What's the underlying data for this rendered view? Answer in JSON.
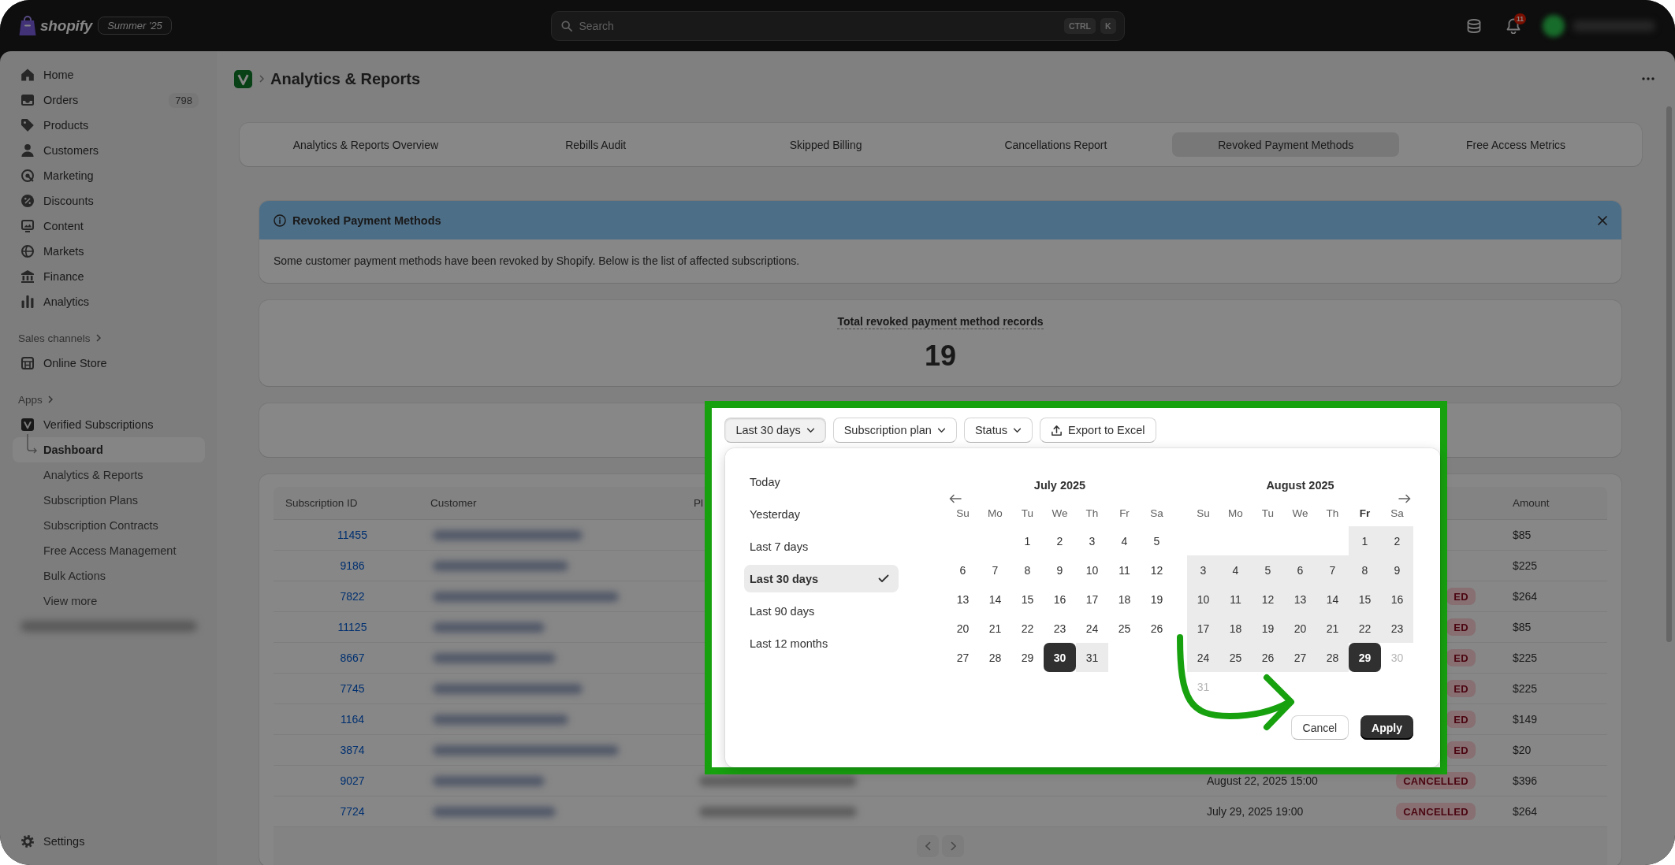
{
  "top_bar": {
    "brand": "shopify",
    "edition": "Summer '25",
    "search": {
      "placeholder": "Search",
      "shortcut": [
        "CTRL",
        "K"
      ]
    },
    "notification_count": "11"
  },
  "sidebar": {
    "items": [
      {
        "label": "Home",
        "selected": false
      },
      {
        "label": "Orders",
        "badge": "798",
        "selected": false
      },
      {
        "label": "Products",
        "selected": false
      },
      {
        "label": "Customers",
        "selected": false
      },
      {
        "label": "Marketing",
        "selected": false
      },
      {
        "label": "Discounts",
        "selected": false
      },
      {
        "label": "Content",
        "selected": false
      },
      {
        "label": "Markets",
        "selected": false
      },
      {
        "label": "Finance",
        "selected": false
      },
      {
        "label": "Analytics",
        "selected": false
      }
    ],
    "sections": [
      {
        "heading": "Sales channels",
        "items": [
          {
            "kind": "link",
            "label": "Online Store",
            "selected": false
          }
        ]
      },
      {
        "heading": "Apps",
        "items": [
          {
            "kind": "link",
            "label": "Verified Subscriptions",
            "selected": false,
            "children": [
              {
                "label": "Dashboard",
                "selected": true
              },
              {
                "label": "Analytics & Reports",
                "selected": false
              },
              {
                "label": "Subscription Plans",
                "selected": false
              },
              {
                "label": "Subscription Contracts",
                "selected": false
              },
              {
                "label": "Free Access Management",
                "selected": false
              },
              {
                "label": "Bulk Actions",
                "selected": false
              },
              {
                "label": "View more",
                "selected": false
              }
            ]
          },
          {
            "kind": "blurred"
          }
        ]
      }
    ],
    "footer_items": [
      {
        "label": "Settings",
        "selected": false
      }
    ]
  },
  "page": {
    "title": "Analytics & Reports"
  },
  "tabs": [
    {
      "label": "Analytics & Reports Overview",
      "selected": false
    },
    {
      "label": "Rebills Audit",
      "selected": false
    },
    {
      "label": "Skipped Billing",
      "selected": false
    },
    {
      "label": "Cancellations Report",
      "selected": false
    },
    {
      "label": "Revoked Payment Methods",
      "selected": true
    },
    {
      "label": "Free Access Metrics",
      "selected": false
    }
  ],
  "banner": {
    "title": "Revoked Payment Methods",
    "message": "Some customer payment methods have been revoked by Shopify. Below is the list of affected subscriptions."
  },
  "summary": {
    "label": "Total revoked payment method records",
    "value": "19"
  },
  "filters": [
    {
      "kind": "dropdown",
      "label": "Last 30 days",
      "expanded": true
    },
    {
      "kind": "dropdown",
      "label": "Subscription plan",
      "expanded": false
    },
    {
      "kind": "dropdown",
      "label": "Status",
      "expanded": false
    },
    {
      "kind": "export",
      "label": "Export to Excel",
      "expanded": false
    }
  ],
  "date_picker": {
    "presets": [
      {
        "label": "Today",
        "selected": false
      },
      {
        "label": "Yesterday",
        "selected": false
      },
      {
        "label": "Last 7 days",
        "selected": false
      },
      {
        "label": "Last 30 days",
        "selected": true
      },
      {
        "label": "Last 90 days",
        "selected": false
      },
      {
        "label": "Last 12 months",
        "selected": false
      }
    ],
    "months": [
      {
        "title": "July 2025",
        "weekdays": [
          {
            "label": "Su",
            "current": false
          },
          {
            "label": "Mo",
            "current": false
          },
          {
            "label": "Tu",
            "current": false
          },
          {
            "label": "We",
            "current": false
          },
          {
            "label": "Th",
            "current": false
          },
          {
            "label": "Fr",
            "current": false
          },
          {
            "label": "Sa",
            "current": false
          }
        ],
        "weeks": [
          [
            {
              "label": "1",
              "selected": false,
              "in_range": false,
              "disabled": false
            },
            {
              "label": "2",
              "selected": false,
              "in_range": false,
              "disabled": false
            },
            {
              "label": "3",
              "selected": false,
              "in_range": false,
              "disabled": false
            },
            {
              "label": "4",
              "selected": false,
              "in_range": false,
              "disabled": false
            },
            {
              "label": "5",
              "selected": false,
              "in_range": false,
              "disabled": false
            }
          ],
          [
            {
              "label": "6",
              "selected": false,
              "in_range": false,
              "disabled": false
            },
            {
              "label": "7",
              "selected": false,
              "in_range": false,
              "disabled": false
            },
            {
              "label": "8",
              "selected": false,
              "in_range": false,
              "disabled": false
            },
            {
              "label": "9",
              "selected": false,
              "in_range": false,
              "disabled": false
            },
            {
              "label": "10",
              "selected": false,
              "in_range": false,
              "disabled": false
            },
            {
              "label": "11",
              "selected": false,
              "in_range": false,
              "disabled": false
            },
            {
              "label": "12",
              "selected": false,
              "in_range": false,
              "disabled": false
            }
          ],
          [
            {
              "label": "13",
              "selected": false,
              "in_range": false,
              "disabled": false
            },
            {
              "label": "14",
              "selected": false,
              "in_range": false,
              "disabled": false
            },
            {
              "label": "15",
              "selected": false,
              "in_range": false,
              "disabled": false
            },
            {
              "label": "16",
              "selected": false,
              "in_range": false,
              "disabled": false
            },
            {
              "label": "17",
              "selected": false,
              "in_range": false,
              "disabled": false
            },
            {
              "label": "18",
              "selected": false,
              "in_range": false,
              "disabled": false
            },
            {
              "label": "19",
              "selected": false,
              "in_range": false,
              "disabled": false
            }
          ],
          [
            {
              "label": "20",
              "selected": false,
              "in_range": false,
              "disabled": false
            },
            {
              "label": "21",
              "selected": false,
              "in_range": false,
              "disabled": false
            },
            {
              "label": "22",
              "selected": false,
              "in_range": false,
              "disabled": false
            },
            {
              "label": "23",
              "selected": false,
              "in_range": false,
              "disabled": false
            },
            {
              "label": "24",
              "selected": false,
              "in_range": false,
              "disabled": false
            },
            {
              "label": "25",
              "selected": false,
              "in_range": false,
              "disabled": false
            },
            {
              "label": "26",
              "selected": false,
              "in_range": false,
              "disabled": false
            }
          ],
          [
            {
              "label": "27",
              "selected": false,
              "in_range": false,
              "disabled": false
            },
            {
              "label": "28",
              "selected": false,
              "in_range": false,
              "disabled": false
            },
            {
              "label": "29",
              "selected": false,
              "in_range": false,
              "disabled": false
            },
            {
              "label": "30",
              "selected": true,
              "in_range": false,
              "disabled": false
            },
            {
              "label": "31",
              "selected": false,
              "in_range": true,
              "disabled": false
            }
          ]
        ]
      },
      {
        "title": "August 2025",
        "weekdays": [
          {
            "label": "Su",
            "current": false
          },
          {
            "label": "Mo",
            "current": false
          },
          {
            "label": "Tu",
            "current": false
          },
          {
            "label": "We",
            "current": false
          },
          {
            "label": "Th",
            "current": false
          },
          {
            "label": "Fr",
            "current": true
          },
          {
            "label": "Sa",
            "current": false
          }
        ],
        "weeks": [
          [
            {
              "label": "1",
              "selected": false,
              "in_range": true,
              "disabled": false
            },
            {
              "label": "2",
              "selected": false,
              "in_range": true,
              "disabled": false
            }
          ],
          [
            {
              "label": "3",
              "selected": false,
              "in_range": true,
              "disabled": false
            },
            {
              "label": "4",
              "selected": false,
              "in_range": true,
              "disabled": false
            },
            {
              "label": "5",
              "selected": false,
              "in_range": true,
              "disabled": false
            },
            {
              "label": "6",
              "selected": false,
              "in_range": true,
              "disabled": false
            },
            {
              "label": "7",
              "selected": false,
              "in_range": true,
              "disabled": false
            },
            {
              "label": "8",
              "selected": false,
              "in_range": true,
              "disabled": false
            },
            {
              "label": "9",
              "selected": false,
              "in_range": true,
              "disabled": false
            }
          ],
          [
            {
              "label": "10",
              "selected": false,
              "in_range": true,
              "disabled": false
            },
            {
              "label": "11",
              "selected": false,
              "in_range": true,
              "disabled": false
            },
            {
              "label": "12",
              "selected": false,
              "in_range": true,
              "disabled": false
            },
            {
              "label": "13",
              "selected": false,
              "in_range": true,
              "disabled": false
            },
            {
              "label": "14",
              "selected": false,
              "in_range": true,
              "disabled": false
            },
            {
              "label": "15",
              "selected": false,
              "in_range": true,
              "disabled": false
            },
            {
              "label": "16",
              "selected": false,
              "in_range": true,
              "disabled": false
            }
          ],
          [
            {
              "label": "17",
              "selected": false,
              "in_range": true,
              "disabled": false
            },
            {
              "label": "18",
              "selected": false,
              "in_range": true,
              "disabled": false
            },
            {
              "label": "19",
              "selected": false,
              "in_range": true,
              "disabled": false
            },
            {
              "label": "20",
              "selected": false,
              "in_range": true,
              "disabled": false
            },
            {
              "label": "21",
              "selected": false,
              "in_range": true,
              "disabled": false
            },
            {
              "label": "22",
              "selected": false,
              "in_range": true,
              "disabled": false
            },
            {
              "label": "23",
              "selected": false,
              "in_range": true,
              "disabled": false
            }
          ],
          [
            {
              "label": "24",
              "selected": false,
              "in_range": true,
              "disabled": false
            },
            {
              "label": "25",
              "selected": false,
              "in_range": true,
              "disabled": false
            },
            {
              "label": "26",
              "selected": false,
              "in_range": true,
              "disabled": false
            },
            {
              "label": "27",
              "selected": false,
              "in_range": true,
              "disabled": false
            },
            {
              "label": "28",
              "selected": false,
              "in_range": true,
              "disabled": false
            },
            {
              "label": "29",
              "selected": true,
              "in_range": false,
              "disabled": false
            },
            {
              "label": "30",
              "selected": false,
              "in_range": false,
              "disabled": true
            }
          ],
          [
            {
              "label": "31",
              "selected": false,
              "in_range": false,
              "disabled": true
            }
          ]
        ]
      }
    ],
    "actions": [
      {
        "kind": "secondary",
        "label": "Cancel"
      },
      {
        "kind": "primary",
        "label": "Apply"
      }
    ]
  },
  "table": {
    "columns": [
      {
        "kind": "id",
        "label": "Subscription ID"
      },
      {
        "kind": "customer",
        "label": "Customer"
      },
      {
        "kind": "plan",
        "label": "Pl"
      },
      {
        "kind": "amount",
        "label": "Amount"
      }
    ],
    "rows": [
      {
        "id": "11455",
        "plan_blurred": false,
        "amount": "$85"
      },
      {
        "id": "9186",
        "plan_blurred": false,
        "amount": "$225"
      },
      {
        "id": "7822",
        "plan_blurred": false,
        "status": "ED",
        "amount": "$264"
      },
      {
        "id": "11125",
        "plan_blurred": false,
        "status": "ED",
        "amount": "$85"
      },
      {
        "id": "8667",
        "plan_blurred": false,
        "status": "ED",
        "amount": "$225"
      },
      {
        "id": "7745",
        "plan_blurred": false,
        "status": "ED",
        "amount": "$225"
      },
      {
        "id": "1164",
        "plan_blurred": false,
        "status": "ED",
        "amount": "$149"
      },
      {
        "id": "3874",
        "plan_blurred": false,
        "status": "ED",
        "amount": "$20"
      },
      {
        "id": "9027",
        "plan_blurred": true,
        "date": "August 22, 2025 15:00",
        "status": "CANCELLED",
        "amount": "$396"
      },
      {
        "id": "7724",
        "plan_blurred": true,
        "date": "July 29, 2025 19:00",
        "status": "CANCELLED",
        "amount": "$264"
      }
    ]
  },
  "annotation": {
    "highlight_frame": true,
    "arrow": true
  }
}
